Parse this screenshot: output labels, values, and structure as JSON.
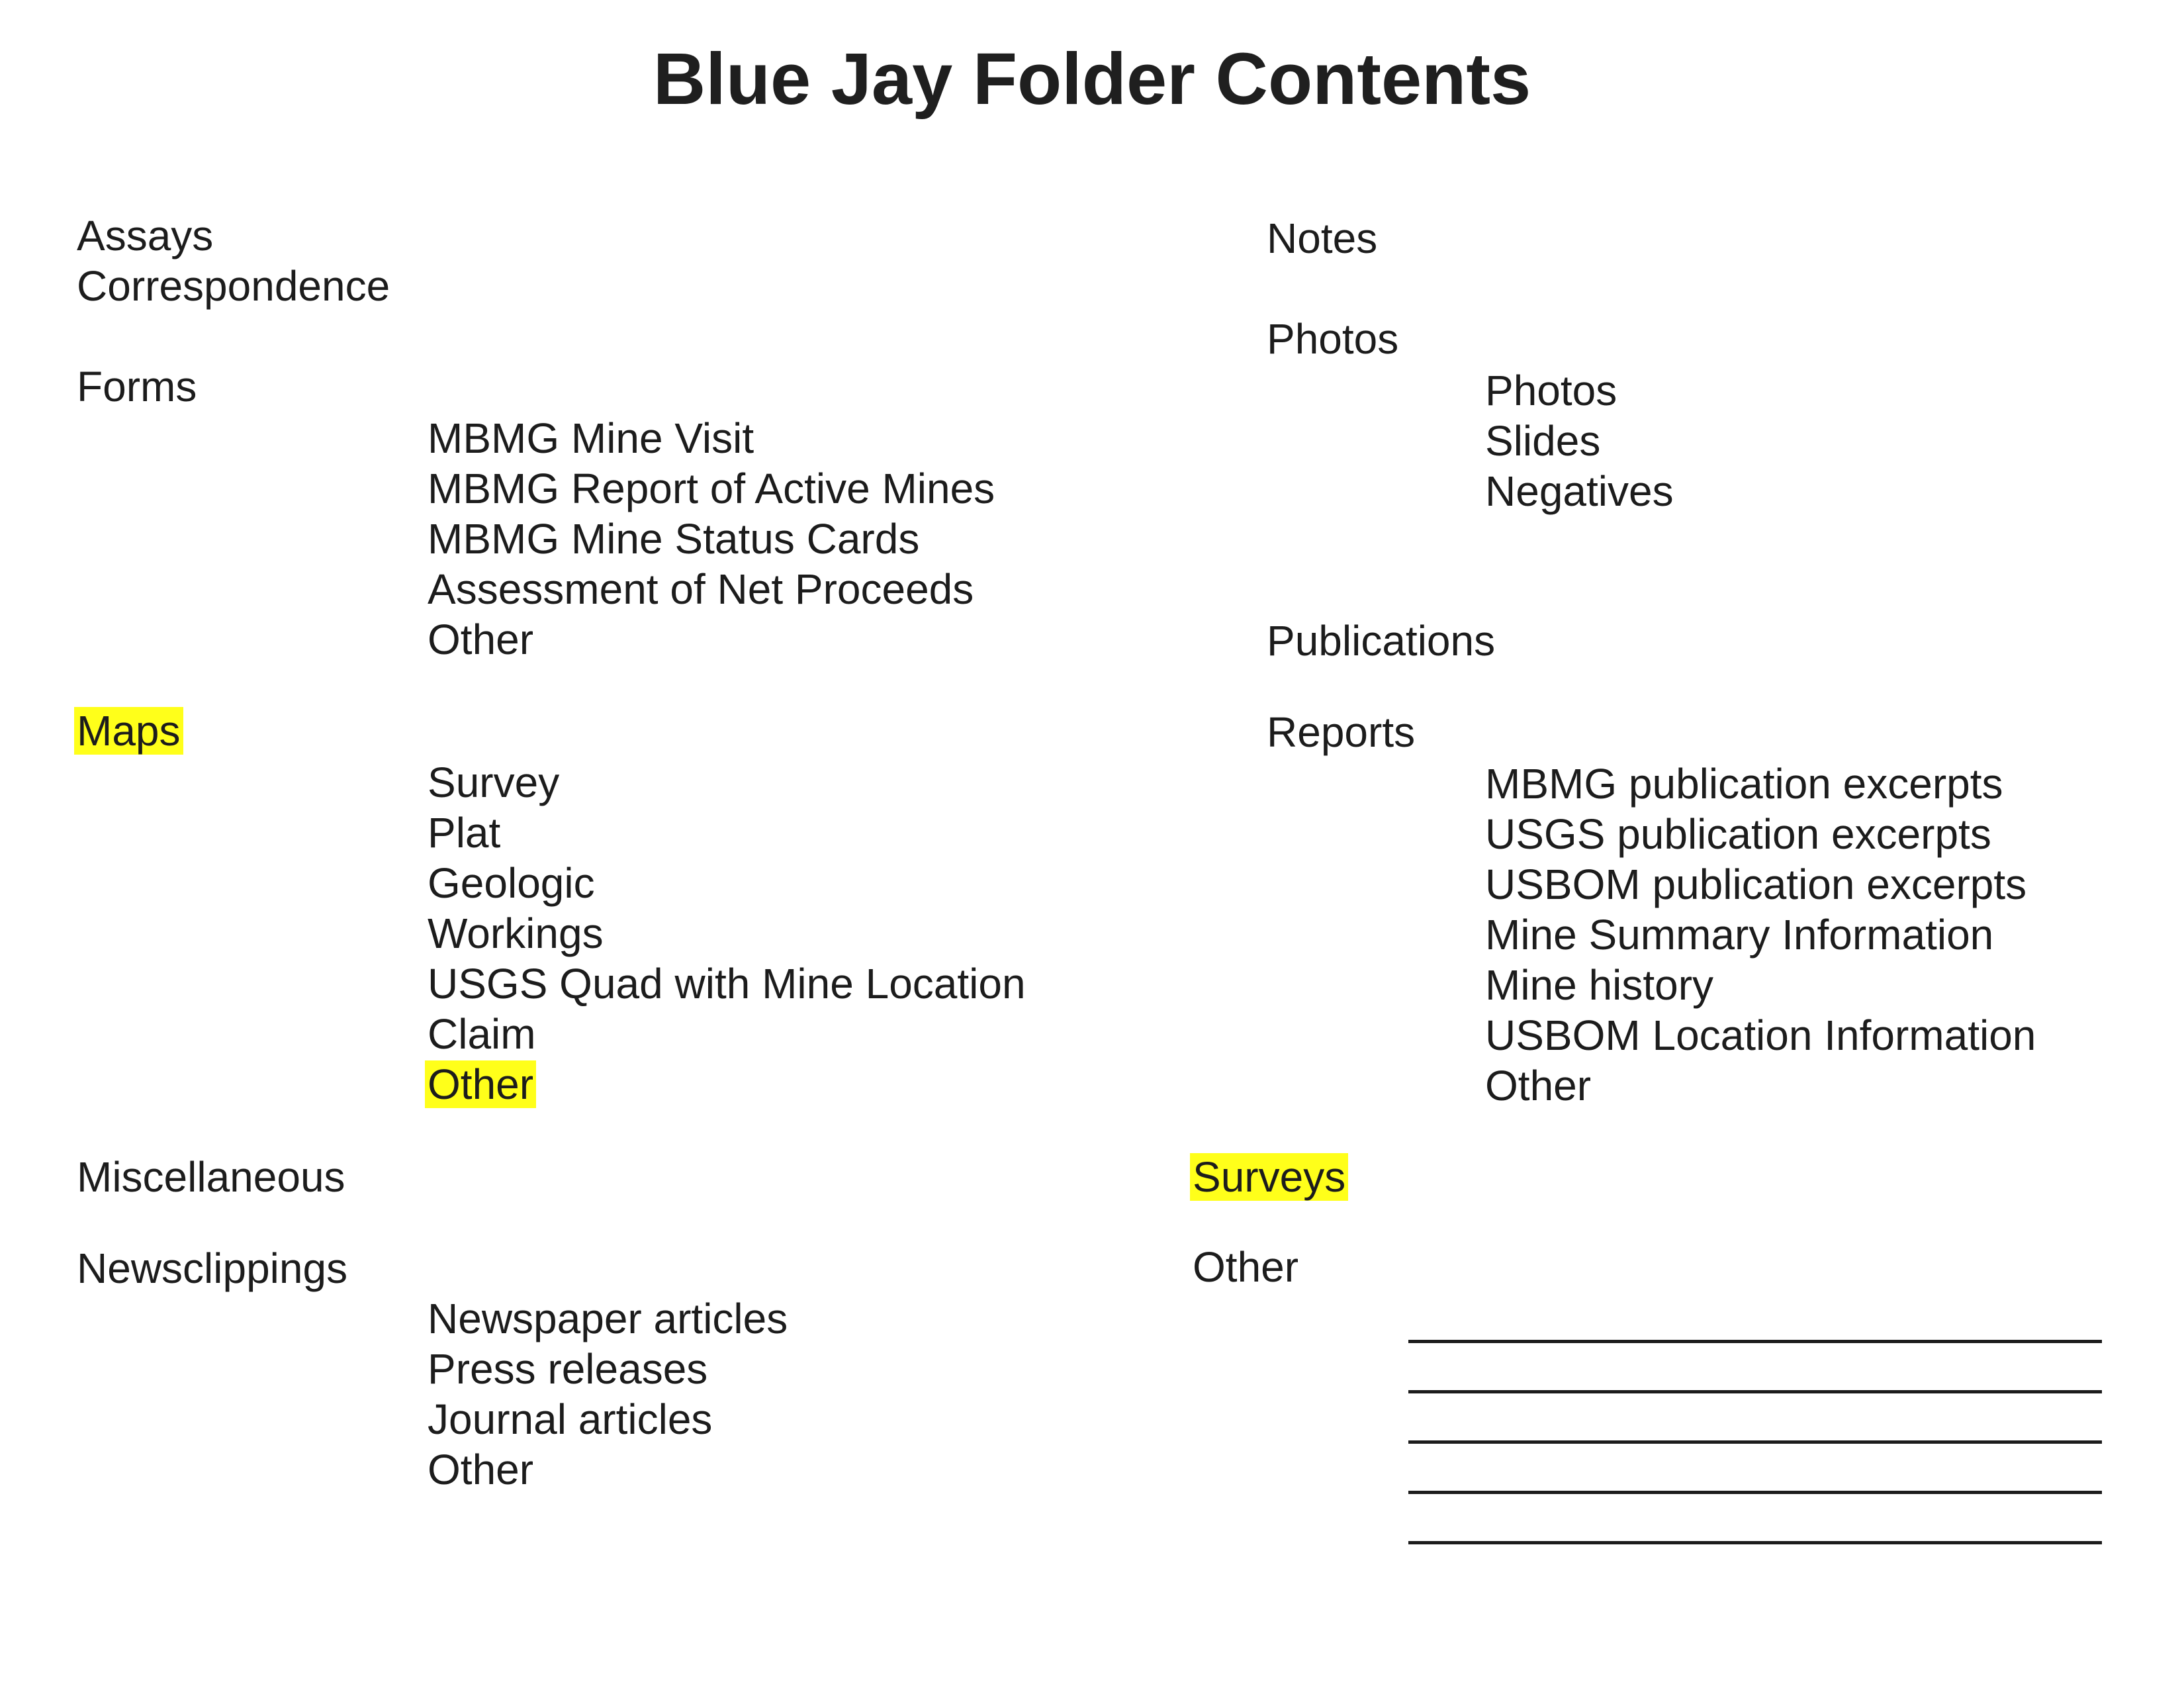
{
  "title": "Blue Jay Folder Contents",
  "left": {
    "assays": "Assays",
    "correspondence": "Correspondence",
    "forms": {
      "label": "Forms",
      "items": [
        "MBMG Mine Visit",
        "MBMG Report of Active Mines",
        "MBMG Mine Status Cards",
        "Assessment of Net Proceeds",
        "Other"
      ]
    },
    "maps": {
      "label": "Maps",
      "highlighted": true,
      "items": [
        "Survey",
        "Plat",
        "Geologic",
        "Workings",
        "USGS Quad with Mine Location",
        "Claim",
        "Other"
      ],
      "highlighted_item": "Other"
    },
    "miscellaneous": "Miscellaneous",
    "newsclippings": {
      "label": "Newsclippings",
      "items": [
        "Newspaper articles",
        "Press releases",
        "Journal articles",
        "Other"
      ]
    }
  },
  "right": {
    "notes": "Notes",
    "photos": {
      "label": "Photos",
      "items": [
        "Photos",
        "Slides",
        "Negatives"
      ]
    },
    "publications": "Publications",
    "reports": {
      "label": "Reports",
      "items": [
        "MBMG publication excerpts",
        "USGS publication excerpts",
        "USBOM publication excerpts",
        "Mine Summary Information",
        "Mine history",
        "USBOM Location Information",
        "Other"
      ]
    },
    "surveys": {
      "label": "Surveys",
      "highlighted": true
    },
    "other": {
      "label": "Other",
      "blank_lines": 5
    }
  },
  "colors": {
    "highlight": "#ffff1a",
    "text": "#1c1c1c"
  }
}
